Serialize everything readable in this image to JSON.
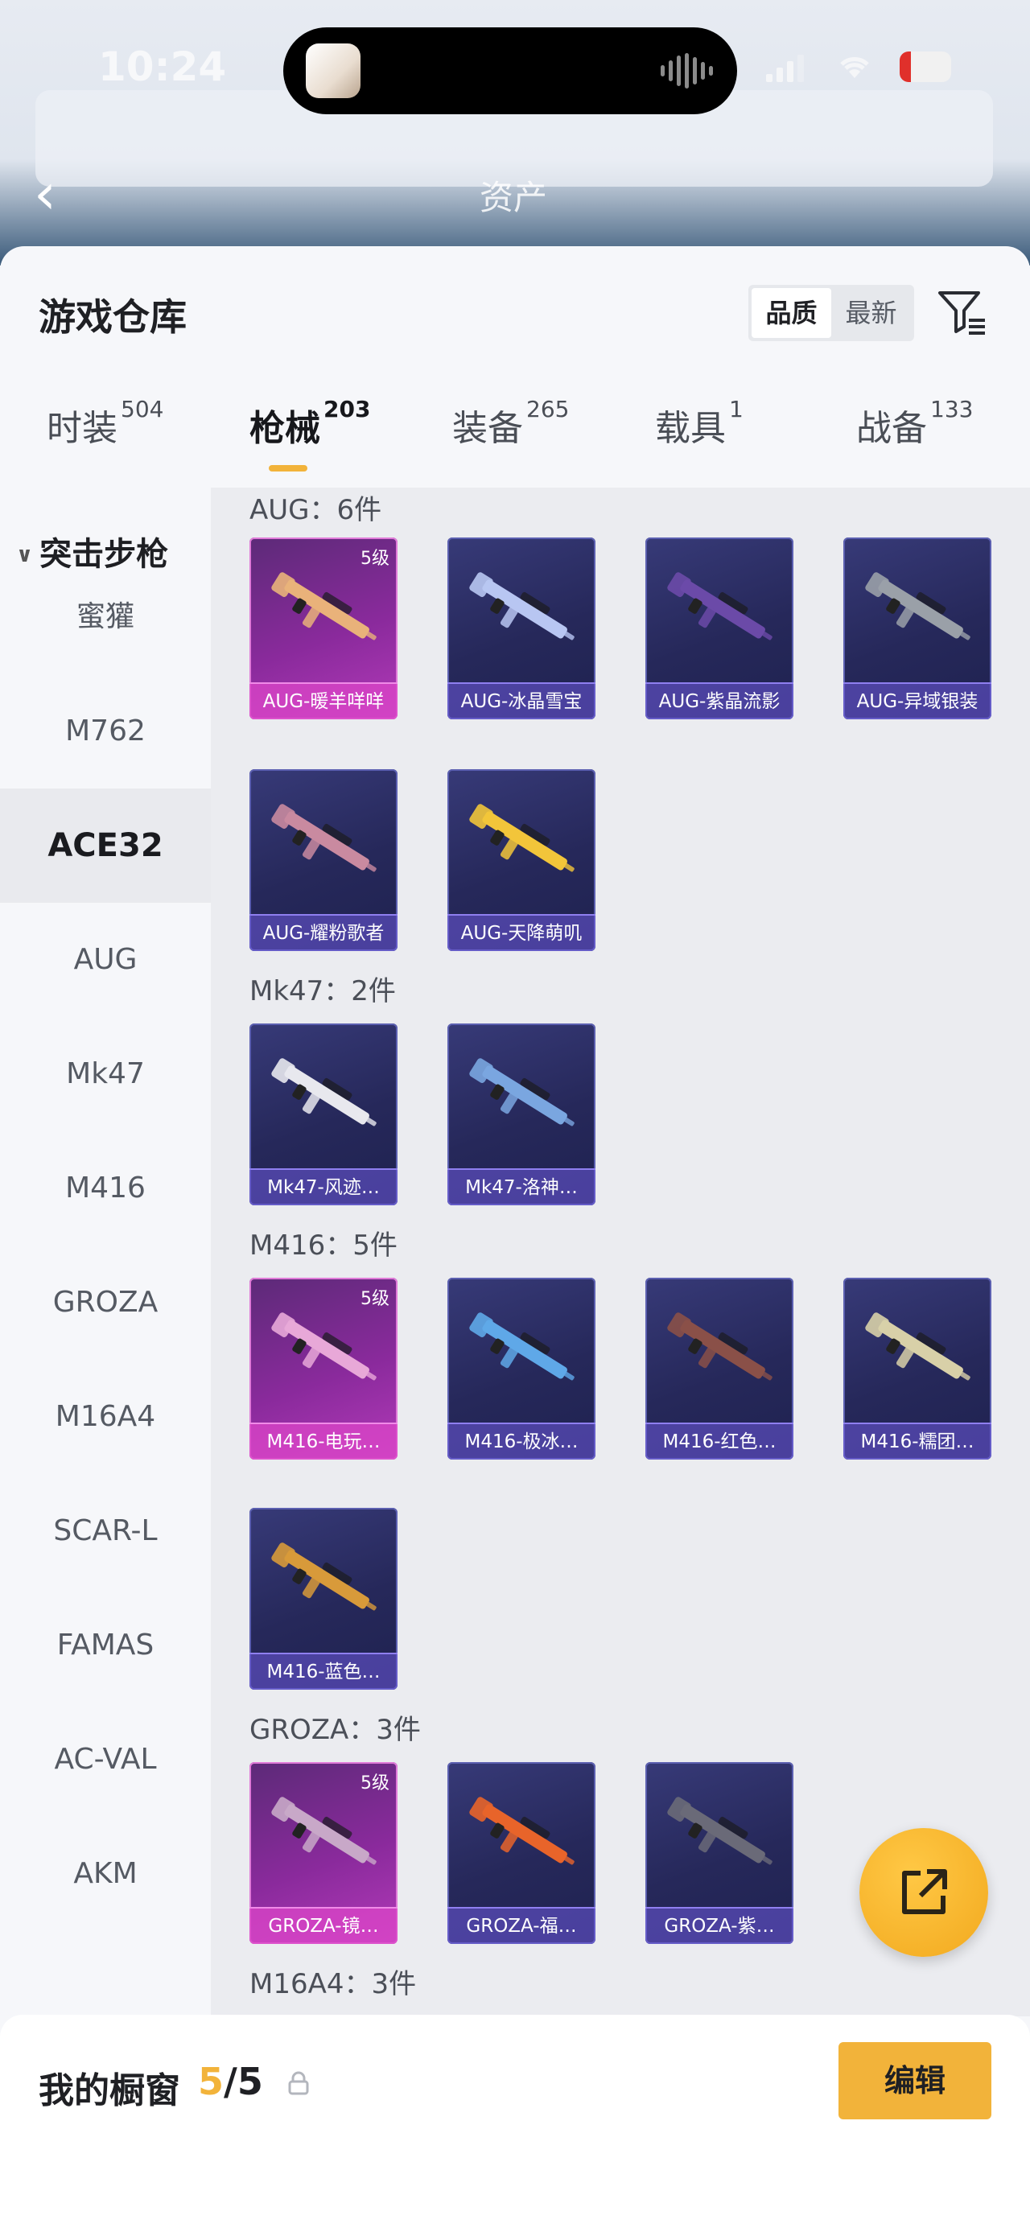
{
  "status_bar": {
    "time": "10:24",
    "battery": "12"
  },
  "nav": {
    "back_icon": "chevron-left-icon",
    "title": "资产"
  },
  "sheet": {
    "title": "游戏仓库",
    "sort": [
      {
        "label": "品质",
        "active": true
      },
      {
        "label": "最新",
        "active": false
      }
    ],
    "filter_icon": "filter-list-icon"
  },
  "tabs": [
    {
      "label": "时装",
      "count": "504"
    },
    {
      "label": "枪械",
      "count": "203",
      "active": true
    },
    {
      "label": "装备",
      "count": "265"
    },
    {
      "label": "载具",
      "count": "1"
    },
    {
      "label": "战备",
      "count": "133"
    }
  ],
  "sidebar": {
    "category": "突击步枪",
    "items": [
      "蜜獾",
      "M762",
      "ACE32",
      "AUG",
      "Mk47",
      "M416",
      "GROZA",
      "M16A4",
      "SCAR-L",
      "FAMAS",
      "AC-VAL",
      "AKM"
    ],
    "active": "ACE32"
  },
  "groups": [
    {
      "label": "AUG：6件",
      "items": [
        {
          "name": "AUG-暖羊咩咩",
          "level": "5级",
          "gold": true,
          "color": "#e9b27a"
        },
        {
          "name": "AUG-冰晶雪宝",
          "color": "#b8c6f2"
        },
        {
          "name": "AUG-紫晶流影",
          "color": "#6b4aa8"
        },
        {
          "name": "AUG-异域银装",
          "color": "#9aa0a8"
        },
        {
          "name": "AUG-耀粉歌者",
          "color": "#c98aa0"
        },
        {
          "name": "AUG-天降萌叽",
          "color": "#f2c53a"
        }
      ]
    },
    {
      "label": "Mk47：2件",
      "items": [
        {
          "name": "Mk47-风迹…",
          "color": "#e8e8ee"
        },
        {
          "name": "Mk47-洛神…",
          "color": "#7aa6e0"
        }
      ]
    },
    {
      "label": "M416：5件",
      "items": [
        {
          "name": "M416-电玩…",
          "level": "5级",
          "gold": true,
          "color": "#e8a8d8"
        },
        {
          "name": "M416-极冰…",
          "color": "#5fa8e8"
        },
        {
          "name": "M416-红色…",
          "color": "#8a5048"
        },
        {
          "name": "M416-糯团…",
          "color": "#d8d0a8"
        },
        {
          "name": "M416-蓝色…",
          "color": "#d89a3a"
        }
      ]
    },
    {
      "label": "GROZA：3件",
      "items": [
        {
          "name": "GROZA-镜…",
          "level": "5级",
          "gold": true,
          "color": "#c8a8c8"
        },
        {
          "name": "GROZA-福…",
          "color": "#e8642a"
        },
        {
          "name": "GROZA-紫…",
          "color": "#6a6a78"
        }
      ]
    },
    {
      "label": "M16A4：3件",
      "items": []
    }
  ],
  "fab": {
    "icon": "share-external-icon"
  },
  "showcase": {
    "title": "我的橱窗",
    "count": "5",
    "total": "/5",
    "lock_icon": "lock-icon",
    "edit_label": "编辑"
  }
}
